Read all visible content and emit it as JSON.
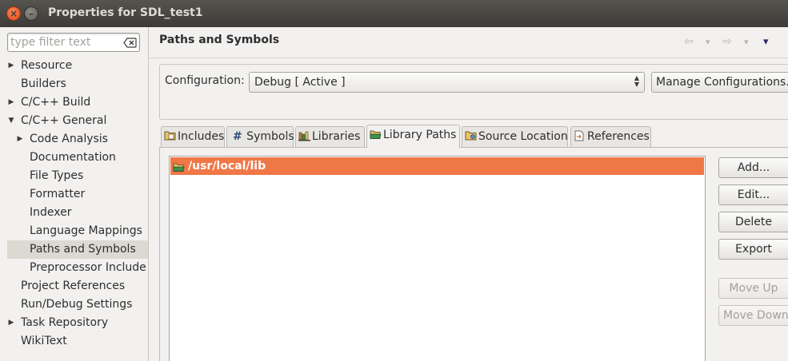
{
  "window": {
    "title": "Properties for SDL_test1",
    "close_glyph": "×",
    "minimize_glyph": "–"
  },
  "filter": {
    "placeholder": "type filter text",
    "value": ""
  },
  "tree": {
    "expanded_glyph": "▼",
    "collapsed_glyph": "▶",
    "items": [
      {
        "label": "Resource",
        "level": 0,
        "arrow": "collapsed"
      },
      {
        "label": "Builders",
        "level": 0,
        "arrow": "none"
      },
      {
        "label": "C/C++ Build",
        "level": 0,
        "arrow": "collapsed"
      },
      {
        "label": "C/C++ General",
        "level": 0,
        "arrow": "expanded"
      },
      {
        "label": "Code Analysis",
        "level": 1,
        "arrow": "collapsed"
      },
      {
        "label": "Documentation",
        "level": 1,
        "arrow": "none"
      },
      {
        "label": "File Types",
        "level": 1,
        "arrow": "none"
      },
      {
        "label": "Formatter",
        "level": 1,
        "arrow": "none"
      },
      {
        "label": "Indexer",
        "level": 1,
        "arrow": "none"
      },
      {
        "label": "Language Mappings",
        "level": 1,
        "arrow": "none"
      },
      {
        "label": "Paths and Symbols",
        "level": 1,
        "arrow": "none",
        "selected": true
      },
      {
        "label": "Preprocessor Include",
        "level": 1,
        "arrow": "none"
      },
      {
        "label": "Project References",
        "level": 0,
        "arrow": "none"
      },
      {
        "label": "Run/Debug Settings",
        "level": 0,
        "arrow": "none"
      },
      {
        "label": "Task Repository",
        "level": 0,
        "arrow": "collapsed"
      },
      {
        "label": "WikiText",
        "level": 0,
        "arrow": "none"
      }
    ]
  },
  "page": {
    "title": "Paths and Symbols",
    "nav": {
      "back_glyph": "⇦",
      "forward_glyph": "⇨",
      "dropdown_glyph": "▾",
      "menu_glyph": "▾"
    }
  },
  "configuration": {
    "label": "Configuration:",
    "selected": "Debug  [ Active ]",
    "manage_label": "Manage Configurations..."
  },
  "tabs": [
    {
      "label": "Includes",
      "icon": "includes-icon"
    },
    {
      "label": " Symbols",
      "icon": "hash-icon",
      "glyph": "#"
    },
    {
      "label": "Libraries",
      "icon": "libraries-icon"
    },
    {
      "label": "Library Paths",
      "icon": "folder-icon",
      "active": true
    },
    {
      "label": "Source Location",
      "icon": "source-location-icon"
    },
    {
      "label": "References",
      "icon": "references-icon"
    }
  ],
  "library_paths": [
    {
      "path": "/usr/local/lib",
      "selected": true
    }
  ],
  "buttons": {
    "add": "Add...",
    "edit": "Edit...",
    "delete": "Delete",
    "export": "Export",
    "move_up": "Move Up",
    "move_down": "Move Down"
  },
  "colors": {
    "selection": "#f07746",
    "title_bar": "#3c3b37",
    "close_button": "#df4a16"
  }
}
